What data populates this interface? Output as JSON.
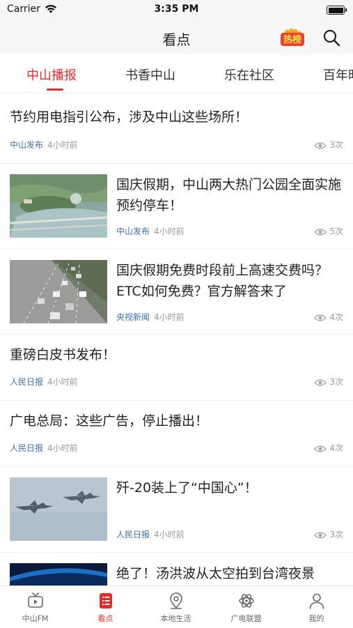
{
  "status_bar": {
    "carrier": "Carrier",
    "time": "3:35 PM"
  },
  "navbar": {
    "title": "看点",
    "hot_badge_label": "热榜"
  },
  "tabs": [
    {
      "label": "中山播报",
      "active": true
    },
    {
      "label": "书香中山",
      "active": false
    },
    {
      "label": "乐在社区",
      "active": false
    },
    {
      "label": "百年时",
      "active": false
    }
  ],
  "articles": [
    {
      "title": "节约用电指引公布，涉及中山这些场所！",
      "source": "中山发布",
      "time": "4小时前",
      "views": "3次",
      "image": null
    },
    {
      "title": "国庆假期，中山两大热门公园全面实施预约停车！",
      "source": "中山发布",
      "time": "4小时前",
      "views": "5次",
      "image": "park-aerial"
    },
    {
      "title": "国庆假期免费时段前上高速交费吗？ETC如何免费？官方解答来了",
      "source": "央视新闻",
      "time": "4小时前",
      "views": "4次",
      "image": "highway-traffic"
    },
    {
      "title": "重磅白皮书发布！",
      "source": "人民日报",
      "time": "4小时前",
      "views": "3次",
      "image": null
    },
    {
      "title": "广电总局：这些广告，停止播出！",
      "source": "人民日报",
      "time": "4小时前",
      "views": "4次",
      "image": null
    },
    {
      "title": "歼-20装上了“中国心”！",
      "source": "人民日报",
      "time": "4小时前",
      "views": "3次",
      "image": "fighter-jets"
    },
    {
      "title": "绝了！汤洪波从太空拍到台湾夜景",
      "source": "",
      "time": "",
      "views": "",
      "image": "earth-from-space"
    }
  ],
  "tabbar": [
    {
      "label": "中山FM",
      "icon": "tv-play-icon",
      "active": false
    },
    {
      "label": "看点",
      "icon": "news-list-icon",
      "active": true
    },
    {
      "label": "本地生活",
      "icon": "location-pin-icon",
      "active": false
    },
    {
      "label": "广电联盟",
      "icon": "atom-icon",
      "active": false
    },
    {
      "label": "我的",
      "icon": "user-icon",
      "active": false
    }
  ],
  "colors": {
    "accent": "#e32b2b",
    "source_link": "#3a6fb2",
    "meta_gray": "#999999"
  }
}
